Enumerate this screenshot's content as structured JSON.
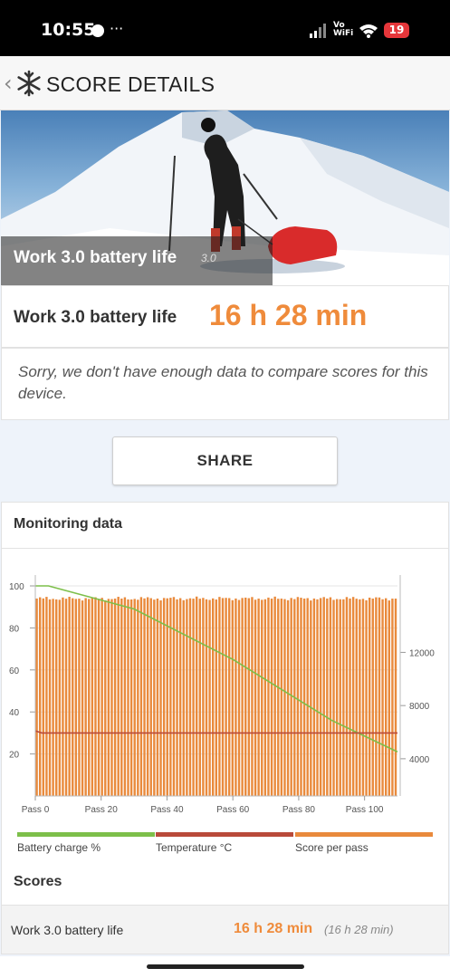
{
  "status": {
    "time": "10:55",
    "more": "···",
    "vowifi_top": "Vo",
    "vowifi_bottom": "WiFi",
    "battery": "19"
  },
  "header": {
    "back_icon": "chevron-left",
    "logo_icon": "snowflake",
    "title": "SCORE DETAILS"
  },
  "hero": {
    "title": "Work 3.0 battery life",
    "version": "3.0"
  },
  "score": {
    "name": "Work 3.0 battery life",
    "value": "16 h 28 min",
    "accent": "#ef8b3b"
  },
  "compare": {
    "message": "Sorry, we don't have enough data to compare scores for this device."
  },
  "share": {
    "label": "SHARE"
  },
  "monitoring": {
    "title": "Monitoring data",
    "legend": [
      {
        "label": "Battery charge %",
        "color": "#7dbf4a"
      },
      {
        "label": "Temperature °C",
        "color": "#b94a3a"
      },
      {
        "label": "Score per pass",
        "color": "#e98a3c"
      }
    ]
  },
  "chart_data": {
    "type": "bar",
    "left_axis_ticks": [
      "100",
      "80",
      "60",
      "40",
      "20"
    ],
    "right_axis_ticks": [
      "12000",
      "8000",
      "4000"
    ],
    "x_tick_labels": [
      "Pass 0",
      "Pass 20",
      "Pass 40",
      "Pass 60",
      "Pass 80",
      "Pass 100"
    ],
    "left_ylim": [
      0,
      100
    ],
    "right_ylim": [
      1200,
      17000
    ],
    "x_range": [
      0,
      110
    ],
    "pass_count": 111,
    "series": [
      {
        "name": "Score per pass",
        "kind": "bar",
        "axis": "right",
        "typical_value": 16050,
        "variation": 150
      },
      {
        "name": "Battery charge %",
        "kind": "line",
        "axis": "left",
        "points": [
          [
            0,
            100
          ],
          [
            4,
            100
          ],
          [
            30,
            89
          ],
          [
            60,
            65
          ],
          [
            90,
            36
          ],
          [
            110,
            21
          ]
        ]
      },
      {
        "name": "Temperature °C",
        "kind": "line",
        "axis": "left",
        "points": [
          [
            0,
            31
          ],
          [
            2,
            30
          ],
          [
            110,
            30
          ]
        ]
      }
    ]
  },
  "scores": {
    "title": "Scores",
    "row": {
      "name": "Work 3.0 battery life",
      "value": "16 h 28 min",
      "sub": "(16 h 28 min)"
    }
  }
}
